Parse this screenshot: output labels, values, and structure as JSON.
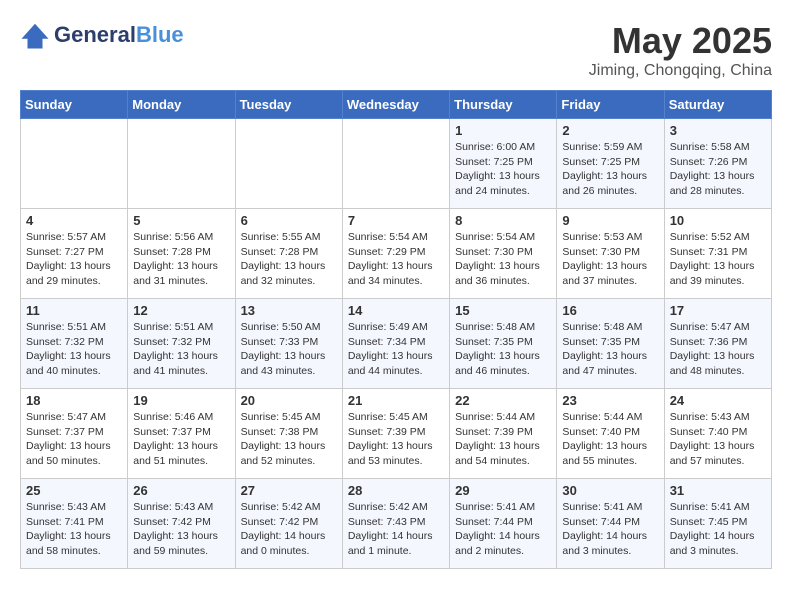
{
  "header": {
    "logo_line1": "General",
    "logo_line2": "Blue",
    "month_year": "May 2025",
    "location": "Jiming, Chongqing, China"
  },
  "weekdays": [
    "Sunday",
    "Monday",
    "Tuesday",
    "Wednesday",
    "Thursday",
    "Friday",
    "Saturday"
  ],
  "weeks": [
    [
      {
        "day": "",
        "info": ""
      },
      {
        "day": "",
        "info": ""
      },
      {
        "day": "",
        "info": ""
      },
      {
        "day": "",
        "info": ""
      },
      {
        "day": "1",
        "info": "Sunrise: 6:00 AM\nSunset: 7:25 PM\nDaylight: 13 hours\nand 24 minutes."
      },
      {
        "day": "2",
        "info": "Sunrise: 5:59 AM\nSunset: 7:25 PM\nDaylight: 13 hours\nand 26 minutes."
      },
      {
        "day": "3",
        "info": "Sunrise: 5:58 AM\nSunset: 7:26 PM\nDaylight: 13 hours\nand 28 minutes."
      }
    ],
    [
      {
        "day": "4",
        "info": "Sunrise: 5:57 AM\nSunset: 7:27 PM\nDaylight: 13 hours\nand 29 minutes."
      },
      {
        "day": "5",
        "info": "Sunrise: 5:56 AM\nSunset: 7:28 PM\nDaylight: 13 hours\nand 31 minutes."
      },
      {
        "day": "6",
        "info": "Sunrise: 5:55 AM\nSunset: 7:28 PM\nDaylight: 13 hours\nand 32 minutes."
      },
      {
        "day": "7",
        "info": "Sunrise: 5:54 AM\nSunset: 7:29 PM\nDaylight: 13 hours\nand 34 minutes."
      },
      {
        "day": "8",
        "info": "Sunrise: 5:54 AM\nSunset: 7:30 PM\nDaylight: 13 hours\nand 36 minutes."
      },
      {
        "day": "9",
        "info": "Sunrise: 5:53 AM\nSunset: 7:30 PM\nDaylight: 13 hours\nand 37 minutes."
      },
      {
        "day": "10",
        "info": "Sunrise: 5:52 AM\nSunset: 7:31 PM\nDaylight: 13 hours\nand 39 minutes."
      }
    ],
    [
      {
        "day": "11",
        "info": "Sunrise: 5:51 AM\nSunset: 7:32 PM\nDaylight: 13 hours\nand 40 minutes."
      },
      {
        "day": "12",
        "info": "Sunrise: 5:51 AM\nSunset: 7:32 PM\nDaylight: 13 hours\nand 41 minutes."
      },
      {
        "day": "13",
        "info": "Sunrise: 5:50 AM\nSunset: 7:33 PM\nDaylight: 13 hours\nand 43 minutes."
      },
      {
        "day": "14",
        "info": "Sunrise: 5:49 AM\nSunset: 7:34 PM\nDaylight: 13 hours\nand 44 minutes."
      },
      {
        "day": "15",
        "info": "Sunrise: 5:48 AM\nSunset: 7:35 PM\nDaylight: 13 hours\nand 46 minutes."
      },
      {
        "day": "16",
        "info": "Sunrise: 5:48 AM\nSunset: 7:35 PM\nDaylight: 13 hours\nand 47 minutes."
      },
      {
        "day": "17",
        "info": "Sunrise: 5:47 AM\nSunset: 7:36 PM\nDaylight: 13 hours\nand 48 minutes."
      }
    ],
    [
      {
        "day": "18",
        "info": "Sunrise: 5:47 AM\nSunset: 7:37 PM\nDaylight: 13 hours\nand 50 minutes."
      },
      {
        "day": "19",
        "info": "Sunrise: 5:46 AM\nSunset: 7:37 PM\nDaylight: 13 hours\nand 51 minutes."
      },
      {
        "day": "20",
        "info": "Sunrise: 5:45 AM\nSunset: 7:38 PM\nDaylight: 13 hours\nand 52 minutes."
      },
      {
        "day": "21",
        "info": "Sunrise: 5:45 AM\nSunset: 7:39 PM\nDaylight: 13 hours\nand 53 minutes."
      },
      {
        "day": "22",
        "info": "Sunrise: 5:44 AM\nSunset: 7:39 PM\nDaylight: 13 hours\nand 54 minutes."
      },
      {
        "day": "23",
        "info": "Sunrise: 5:44 AM\nSunset: 7:40 PM\nDaylight: 13 hours\nand 55 minutes."
      },
      {
        "day": "24",
        "info": "Sunrise: 5:43 AM\nSunset: 7:40 PM\nDaylight: 13 hours\nand 57 minutes."
      }
    ],
    [
      {
        "day": "25",
        "info": "Sunrise: 5:43 AM\nSunset: 7:41 PM\nDaylight: 13 hours\nand 58 minutes."
      },
      {
        "day": "26",
        "info": "Sunrise: 5:43 AM\nSunset: 7:42 PM\nDaylight: 13 hours\nand 59 minutes."
      },
      {
        "day": "27",
        "info": "Sunrise: 5:42 AM\nSunset: 7:42 PM\nDaylight: 14 hours\nand 0 minutes."
      },
      {
        "day": "28",
        "info": "Sunrise: 5:42 AM\nSunset: 7:43 PM\nDaylight: 14 hours\nand 1 minute."
      },
      {
        "day": "29",
        "info": "Sunrise: 5:41 AM\nSunset: 7:44 PM\nDaylight: 14 hours\nand 2 minutes."
      },
      {
        "day": "30",
        "info": "Sunrise: 5:41 AM\nSunset: 7:44 PM\nDaylight: 14 hours\nand 3 minutes."
      },
      {
        "day": "31",
        "info": "Sunrise: 5:41 AM\nSunset: 7:45 PM\nDaylight: 14 hours\nand 3 minutes."
      }
    ]
  ]
}
